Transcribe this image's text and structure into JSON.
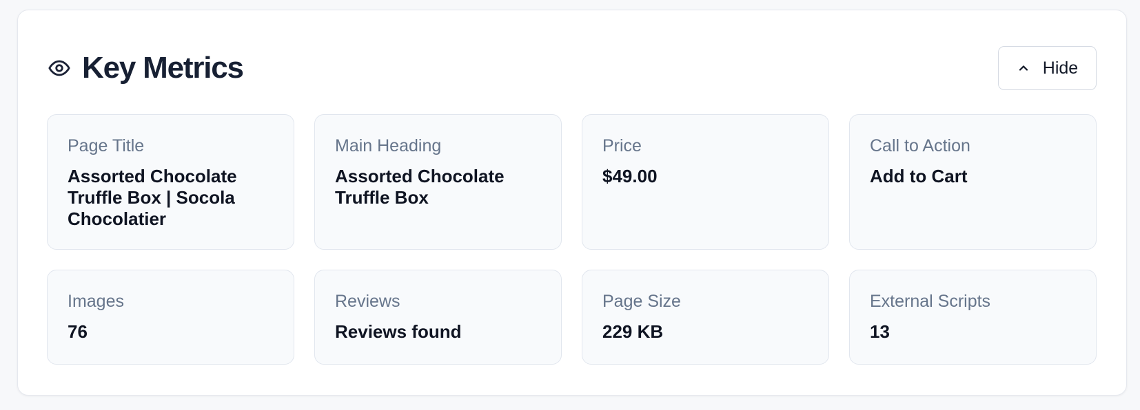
{
  "panel": {
    "title": "Key Metrics",
    "icon": "eye-icon",
    "hide_button": {
      "label": "Hide",
      "icon": "chevron-up-icon"
    }
  },
  "metrics": [
    {
      "label": "Page Title",
      "value": "Assorted Chocolate Truffle Box | Socola Chocolatier"
    },
    {
      "label": "Main Heading",
      "value": "Assorted Chocolate Truffle Box"
    },
    {
      "label": "Price",
      "value": "$49.00"
    },
    {
      "label": "Call to Action",
      "value": "Add to Cart"
    },
    {
      "label": "Images",
      "value": "76"
    },
    {
      "label": "Reviews",
      "value": "Reviews found"
    },
    {
      "label": "Page Size",
      "value": "229 KB"
    },
    {
      "label": "External Scripts",
      "value": "13"
    }
  ],
  "colors": {
    "background": "#f7f8fa",
    "panel": "#ffffff",
    "card": "#f8fafc",
    "title": "#172033",
    "label": "#66758b",
    "value": "#0f1422",
    "border": "#e1e6ee"
  }
}
